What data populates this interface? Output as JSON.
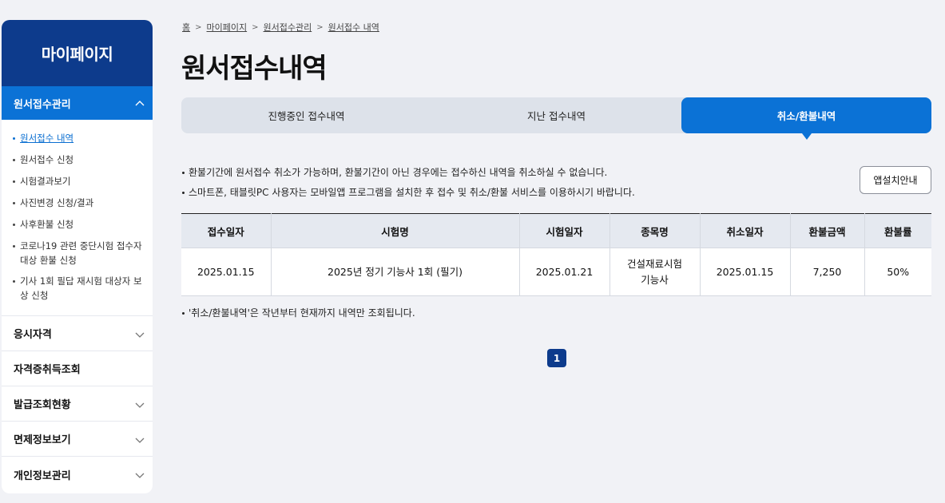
{
  "sidebar": {
    "title": "마이페이지",
    "active_section": "원서접수관리",
    "sub_items": [
      {
        "label": "원서접수 내역"
      },
      {
        "label": "원서접수 신청"
      },
      {
        "label": "시험결과보기"
      },
      {
        "label": "사진변경 신청/결과"
      },
      {
        "label": "사후환불 신청"
      },
      {
        "label": "코로나19 관련 중단시험 접수자 대상 환불 신청"
      },
      {
        "label": "기사 1회 필답 재시험 대상자 보상 신청"
      }
    ],
    "menus": [
      {
        "label": "응시자격",
        "icon": "chevron-down-icon"
      },
      {
        "label": "자격증취득조회",
        "icon": ""
      },
      {
        "label": "발급조회현황",
        "icon": "chevron-down-icon"
      },
      {
        "label": "면제정보보기",
        "icon": "chevron-down-icon"
      },
      {
        "label": "개인정보관리",
        "icon": "chevron-down-icon"
      }
    ]
  },
  "breadcrumb": [
    "홈",
    "마이페이지",
    "원서접수관리",
    "원서접수 내역"
  ],
  "page_title": "원서접수내역",
  "tabs": [
    {
      "label": "진행중인 접수내역"
    },
    {
      "label": "지난 접수내역"
    },
    {
      "label": "취소/환불내역"
    }
  ],
  "active_tab": "취소/환불내역",
  "notes": [
    "환불기간에 원서접수 취소가 가능하며, 환불기간이 아닌 경우에는 접수하신 내역을 취소하실 수 없습니다.",
    "스마트폰, 태블릿PC 사용자는 모바일앱 프로그램을 설치한 후 접수 및 취소/환불 서비스를 이용하시기 바랍니다."
  ],
  "app_button": "앱설치안내",
  "table": {
    "headers": [
      "접수일자",
      "시험명",
      "시험일자",
      "종목명",
      "취소일자",
      "환불금액",
      "환불률"
    ],
    "rows": [
      {
        "receipt_date": "2025.01.15",
        "exam_name": "2025년 정기 기능사 1회 (필기)",
        "exam_date": "2025.01.21",
        "subject_line1": "건설재료시험",
        "subject_line2": "기능사",
        "cancel_date": "2025.01.15",
        "refund_amount": "7,250",
        "refund_rate": "50%"
      }
    ]
  },
  "footnote": "'취소/환불내역'은 작년부터 현재까지 내역만 조회됩니다.",
  "pagination": {
    "current_page": "1"
  },
  "colors": {
    "brand_dark": "#0d3b8c",
    "brand_blue": "#0b72d6",
    "background": "#f1f2f6"
  }
}
